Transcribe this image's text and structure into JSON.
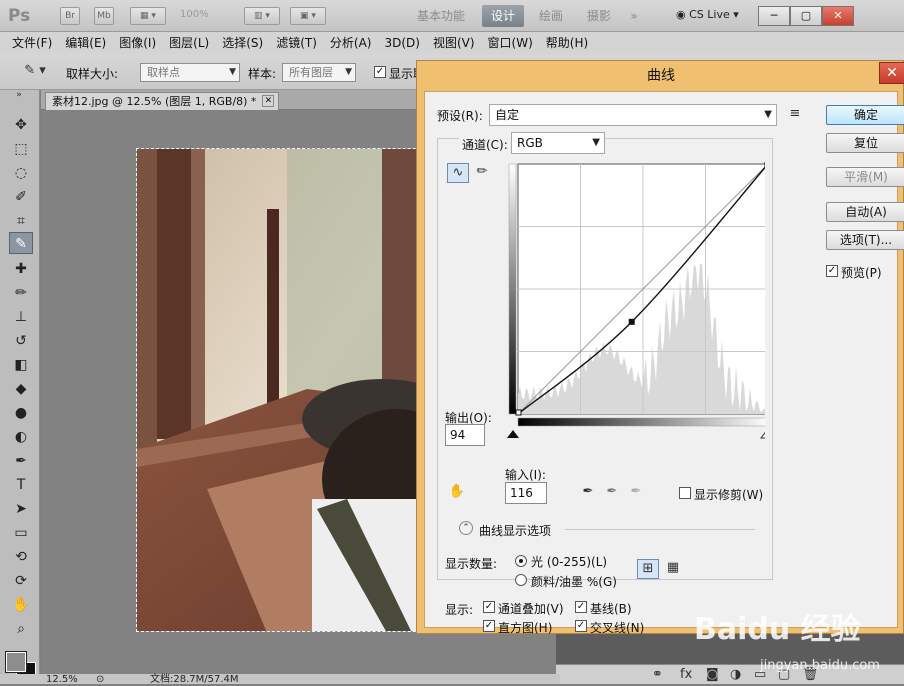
{
  "app": {
    "logo": "Ps",
    "btn_br": "Br",
    "btn_mb": "Mb",
    "zoom_display": "100%",
    "workspaces": [
      "基本功能",
      "设计",
      "绘画",
      "摄影"
    ],
    "workspace_more": "»",
    "cs_live": "CS Live",
    "win_minimize": "─",
    "win_restore": "▢",
    "win_close": "✕"
  },
  "menubar": [
    "文件(F)",
    "编辑(E)",
    "图像(I)",
    "图层(L)",
    "选择(S)",
    "滤镜(T)",
    "分析(A)",
    "3D(D)",
    "视图(V)",
    "窗口(W)",
    "帮助(H)"
  ],
  "options": {
    "sample_size_label": "取样大小:",
    "sample_size_value": "取样点",
    "sample_label": "样本:",
    "sample_value": "所有图层",
    "show_ring_label": "显示取"
  },
  "document": {
    "tab_title": "素材12.jpg @ 12.5% (图层 1, RGB/8) *",
    "tab_close": "✕"
  },
  "status": {
    "zoom": "12.5%",
    "doc_info": "文档:28.7M/57.4M"
  },
  "curves": {
    "title": "曲线",
    "close": "✕",
    "preset_label": "预设(R):",
    "preset_value": "自定",
    "channel_label": "通道(C):",
    "channel_value": "RGB",
    "output_label": "输出(O):",
    "output_value": "94",
    "input_label": "输入(I):",
    "input_value": "116",
    "show_clipping_label": "显示修剪(W)",
    "show_clipping_checked": false,
    "curve_display_options": "曲线显示选项",
    "show_amount_label": "显示数量:",
    "light_label": "光 (0-255)(L)",
    "pigment_label": "颜料/油墨 %(G)",
    "light_selected": true,
    "show_label": "显示:",
    "channel_overlays": "通道叠加(V)",
    "baseline": "基线(B)",
    "histogram": "直方图(H)",
    "intersection_line": "交叉线(N)",
    "buttons": {
      "ok": "确定",
      "reset": "复位",
      "smooth": "平滑(M)",
      "auto": "自动(A)",
      "options": "选项(T)..."
    },
    "preview_label": "预览(P)",
    "preview_checked": true,
    "curve_point": {
      "input": 116,
      "output": 94
    }
  },
  "watermark": {
    "brand": "Baidu 经验",
    "url": "jingyan.baidu.com"
  }
}
